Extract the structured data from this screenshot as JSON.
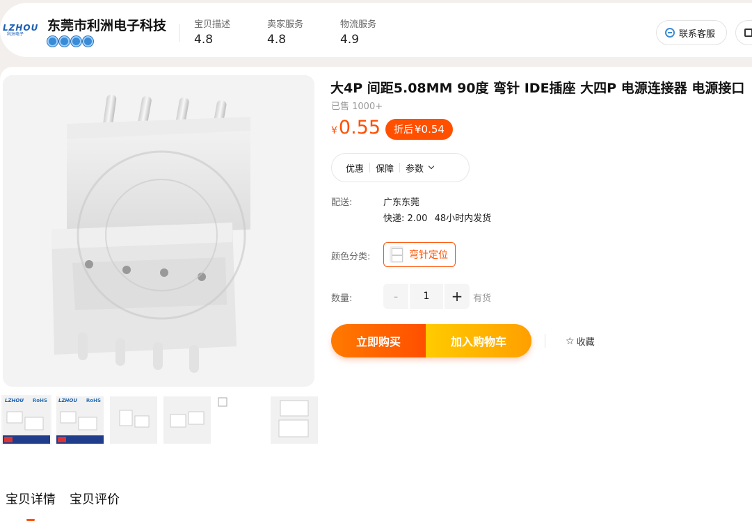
{
  "shop": {
    "logo_text": "LZHOU",
    "logo_sub": "利洲电子",
    "name": "东莞市利洲电子科技",
    "scores": [
      {
        "label": "宝贝描述",
        "value": "4.8"
      },
      {
        "label": "卖家服务",
        "value": "4.8"
      },
      {
        "label": "物流服务",
        "value": "4.9"
      }
    ],
    "customer_service": "联系客服"
  },
  "product": {
    "title": "大4P 间距5.08MM 90度 弯针 IDE插座 大四P 电源连接器 电源接口",
    "sold": "已售 1000+",
    "price_currency": "¥",
    "price": "0.55",
    "after_discount_label": "折后",
    "after_discount_price": "¥0.54",
    "info_tabs": [
      "优惠",
      "保障",
      "参数"
    ],
    "shipping_label": "配送:",
    "ship_from": "广东东莞",
    "express_label": "快递: 2.00",
    "ship_time": "48小时内发货",
    "color_label": "颜色分类:",
    "sku_name": "弯针定位",
    "qty_label": "数量:",
    "qty_minus": "-",
    "qty_value": "1",
    "qty_plus": "+",
    "stock": "有货",
    "buy_now": "立即购买",
    "add_to_cart": "加入购物车",
    "favorite": "收藏",
    "thumb_brand": "LZHOU",
    "thumb_rohs": "RoHS"
  },
  "detail_tabs": [
    "宝贝详情",
    "宝贝评价"
  ],
  "colors": {
    "accent": "#ff5000",
    "brand_blue": "#1a5fb4"
  }
}
